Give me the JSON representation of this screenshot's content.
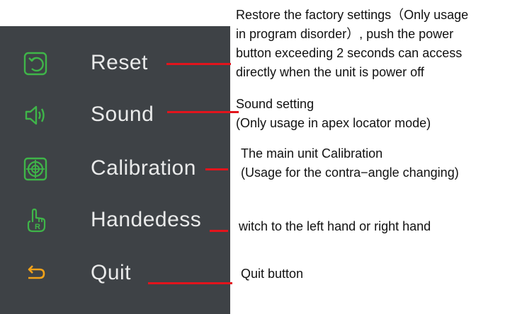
{
  "menu": {
    "items": [
      {
        "label": "Reset",
        "icon": "reset-icon",
        "icon_color": "#3fb549"
      },
      {
        "label": "Sound",
        "icon": "speaker-icon",
        "icon_color": "#3fb549"
      },
      {
        "label": "Calibration",
        "icon": "target-icon",
        "icon_color": "#3fb549"
      },
      {
        "label": "Handedess",
        "icon": "hand-icon",
        "icon_color": "#3fb549"
      },
      {
        "label": "Quit",
        "icon": "back-arrow-icon",
        "icon_color": "#f2a219"
      }
    ]
  },
  "annotations": {
    "reset": [
      "Restore the factory settings（Only usage",
      "in program disorder）, push the power",
      "button exceeding 2 seconds can access",
      "directly when the unit is power off"
    ],
    "sound": [
      "Sound setting",
      "(Only usage in apex locator mode)"
    ],
    "calibration": [
      "The main unit Calibration",
      "(Usage for the contra−angle changing)"
    ],
    "handedness": [
      "witch to the left hand or right hand"
    ],
    "quit": [
      "Quit button"
    ]
  },
  "colors": {
    "panel_background": "#3e4246",
    "menu_text": "#e9eaea",
    "leader_line": "#e3141c",
    "note_text": "#111111"
  }
}
